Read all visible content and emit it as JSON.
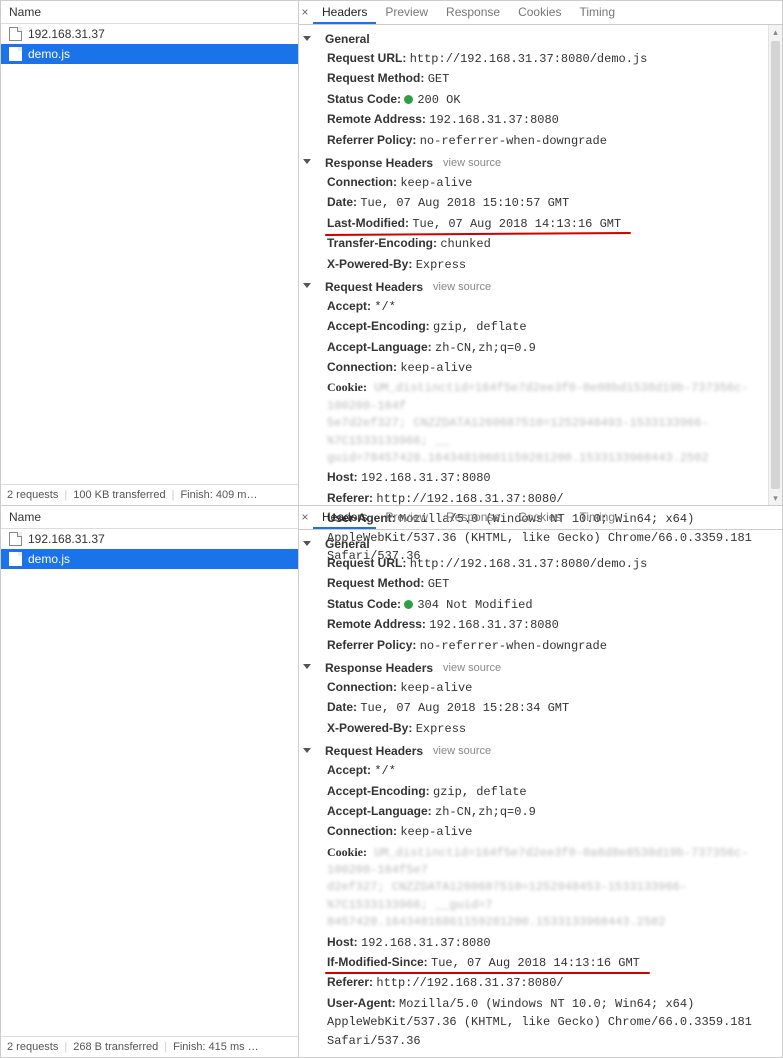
{
  "panels": [
    {
      "left": {
        "header": "Name",
        "files": [
          {
            "name": "192.168.31.37",
            "icon": "doc",
            "selected": false
          },
          {
            "name": "demo.js",
            "icon": "js",
            "selected": true
          }
        ],
        "status": {
          "requests": "2 requests",
          "transferred": "100 KB transferred",
          "finish": "Finish: 409 m…"
        }
      },
      "right": {
        "tabs": [
          "Headers",
          "Preview",
          "Response",
          "Cookies",
          "Timing"
        ],
        "active_tab": 0,
        "sections": {
          "general": {
            "title": "General",
            "items": {
              "request_url": {
                "k": "Request URL:",
                "v": "http://192.168.31.37:8080/demo.js"
              },
              "request_method": {
                "k": "Request Method:",
                "v": "GET"
              },
              "status_code": {
                "k": "Status Code:",
                "v": "200 OK",
                "green_dot": true
              },
              "remote_address": {
                "k": "Remote Address:",
                "v": "192.168.31.37:8080"
              },
              "referrer_policy": {
                "k": "Referrer Policy:",
                "v": "no-referrer-when-downgrade"
              }
            }
          },
          "response_headers": {
            "title": "Response Headers",
            "view_source": "view source",
            "items": {
              "connection": {
                "k": "Connection:",
                "v": "keep-alive"
              },
              "date": {
                "k": "Date:",
                "v": "Tue, 07 Aug 2018 15:10:57 GMT"
              },
              "last_modified": {
                "k": "Last-Modified:",
                "v": "Tue, 07 Aug 2018 14:13:16 GMT",
                "underline": true
              },
              "transfer_encoding": {
                "k": "Transfer-Encoding:",
                "v": "chunked"
              },
              "x_powered_by": {
                "k": "X-Powered-By:",
                "v": "Express"
              }
            }
          },
          "request_headers": {
            "title": "Request Headers",
            "view_source": "view source",
            "items": {
              "accept": {
                "k": "Accept:",
                "v": "*/*"
              },
              "accept_encoding": {
                "k": "Accept-Encoding:",
                "v": "gzip, deflate"
              },
              "accept_language": {
                "k": "Accept-Language:",
                "v": "zh-CN,zh;q=0.9"
              },
              "connection": {
                "k": "Connection:",
                "v": "keep-alive"
              },
              "cookie": {
                "k": "Cookie:",
                "blurred1": "UM_distinctid=164f5e7d2ee3f0-0e08bd1538d19b-737356c-100200-164f",
                "blurred2": "5e7d2ef327; CNZZDATA1260687510=1252948493-1533133966-%7C1533133966; __",
                "blurred3": "guid=78457428.16434810601159281200.1533133968443.2502"
              },
              "host": {
                "k": "Host:",
                "v": "192.168.31.37:8080"
              },
              "referer": {
                "k": "Referer:",
                "v": "http://192.168.31.37:8080/"
              },
              "user_agent": {
                "k": "User-Agent:",
                "v": "Mozilla/5.0 (Windows NT 10.0; Win64; x64) AppleWebKit/537.36 (KHTML, like Gecko) Chrome/66.0.3359.181 Safari/537.36"
              }
            }
          }
        }
      }
    },
    {
      "left": {
        "header": "Name",
        "files": [
          {
            "name": "192.168.31.37",
            "icon": "doc",
            "selected": false
          },
          {
            "name": "demo.js",
            "icon": "js",
            "selected": true
          }
        ],
        "status": {
          "requests": "2 requests",
          "transferred": "268 B transferred",
          "finish": "Finish: 415 ms …"
        }
      },
      "right": {
        "tabs": [
          "Headers",
          "Preview",
          "Response",
          "Cookies",
          "Timing"
        ],
        "active_tab": 0,
        "sections": {
          "general": {
            "title": "General",
            "items": {
              "request_url": {
                "k": "Request URL:",
                "v": "http://192.168.31.37:8080/demo.js"
              },
              "request_method": {
                "k": "Request Method:",
                "v": "GET"
              },
              "status_code": {
                "k": "Status Code:",
                "v": "304 Not Modified",
                "green_dot": true
              },
              "remote_address": {
                "k": "Remote Address:",
                "v": "192.168.31.37:8080"
              },
              "referrer_policy": {
                "k": "Referrer Policy:",
                "v": "no-referrer-when-downgrade"
              }
            }
          },
          "response_headers": {
            "title": "Response Headers",
            "view_source": "view source",
            "items": {
              "connection": {
                "k": "Connection:",
                "v": "keep-alive"
              },
              "date": {
                "k": "Date:",
                "v": "Tue, 07 Aug 2018 15:28:34 GMT"
              },
              "x_powered_by": {
                "k": "X-Powered-By:",
                "v": "Express"
              }
            }
          },
          "request_headers": {
            "title": "Request Headers",
            "view_source": "view source",
            "items": {
              "accept": {
                "k": "Accept:",
                "v": "*/*"
              },
              "accept_encoding": {
                "k": "Accept-Encoding:",
                "v": "gzip, deflate"
              },
              "accept_language": {
                "k": "Accept-Language:",
                "v": "zh-CN,zh;q=0.9"
              },
              "connection": {
                "k": "Connection:",
                "v": "keep-alive"
              },
              "cookie": {
                "k": "Cookie:",
                "blurred1": "UM_distinctid=164f5e7d2ee3f0-0a6d8e8538d19b-737356c-100200-164f5e7",
                "blurred2": "d2ef327; CNZZDATA1260687510=1252948453-1533133966-%7C1533133966; __guid=7",
                "blurred3": "8457428.16434816861159281200.1533133968443.2502"
              },
              "host": {
                "k": "Host:",
                "v": "192.168.31.37:8080"
              },
              "if_modified_since": {
                "k": "If-Modified-Since:",
                "v": "Tue, 07 Aug 2018 14:13:16 GMT",
                "underline": true
              },
              "referer": {
                "k": "Referer:",
                "v": "http://192.168.31.37:8080/"
              },
              "user_agent": {
                "k": "User-Agent:",
                "v": "Mozilla/5.0 (Windows NT 10.0; Win64; x64) AppleWebKit/537.36 (KHTML, like Gecko) Chrome/66.0.3359.181 Safari/537.36"
              }
            }
          }
        }
      }
    }
  ]
}
